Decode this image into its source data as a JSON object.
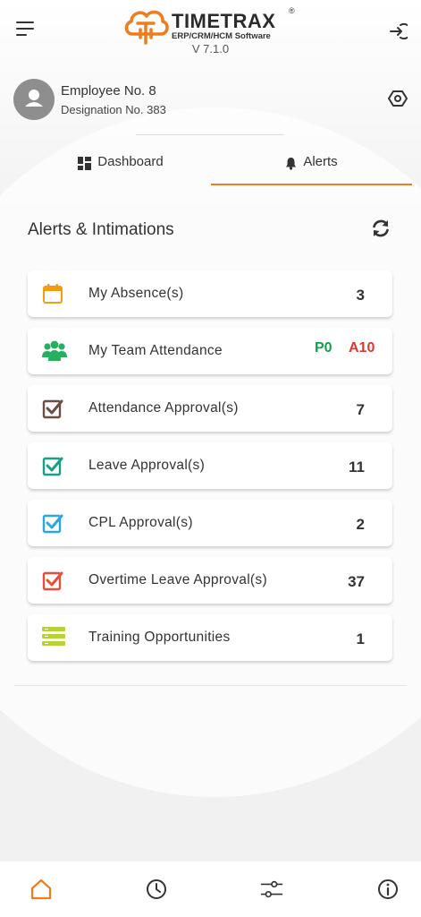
{
  "header": {
    "logo_name": "TIMETRAX",
    "logo_reg": "®",
    "logo_tagline": "ERP/CRM/HCM Software",
    "version": "V 7.1.0"
  },
  "profile": {
    "employee": "Employee No. 8",
    "designation": "Designation No. 383"
  },
  "tabs": [
    {
      "label": "Dashboard",
      "icon": "dashboard-grid-icon",
      "active": false
    },
    {
      "label": "Alerts",
      "icon": "bell-icon",
      "active": true
    }
  ],
  "section": {
    "title": "Alerts & Intimations"
  },
  "alerts": [
    {
      "label": "My Absence(s)",
      "count": "3",
      "icon": "calendar-icon",
      "color": "#f39c12"
    },
    {
      "label": "My Team Attendance",
      "present": "P0",
      "absent": "A10",
      "icon": "team-icon",
      "color": "#27ae60"
    },
    {
      "label": "Attendance Approval(s)",
      "count": "7",
      "icon": "checkbox-icon",
      "color": "#6d4c41"
    },
    {
      "label": "Leave Approval(s)",
      "count": "11",
      "icon": "checkbox-icon",
      "color": "#16a085"
    },
    {
      "label": "CPL Approval(s)",
      "count": "2",
      "icon": "checkbox-icon",
      "color": "#29a8e0"
    },
    {
      "label": "Overtime Leave Approval(s)",
      "count": "37",
      "icon": "checkbox-icon",
      "color": "#e74c3c"
    },
    {
      "label": "Training Opportunities",
      "count": "1",
      "icon": "list-icon",
      "color": "#b5d334"
    }
  ],
  "colors": {
    "accent": "#ee7d1e",
    "present": "#14a04a",
    "absent": "#e0362f"
  },
  "bottom_nav": [
    {
      "icon": "home-icon",
      "active": true
    },
    {
      "icon": "clock-icon",
      "active": false
    },
    {
      "icon": "sliders-icon",
      "active": false
    },
    {
      "icon": "info-icon",
      "active": false
    }
  ]
}
